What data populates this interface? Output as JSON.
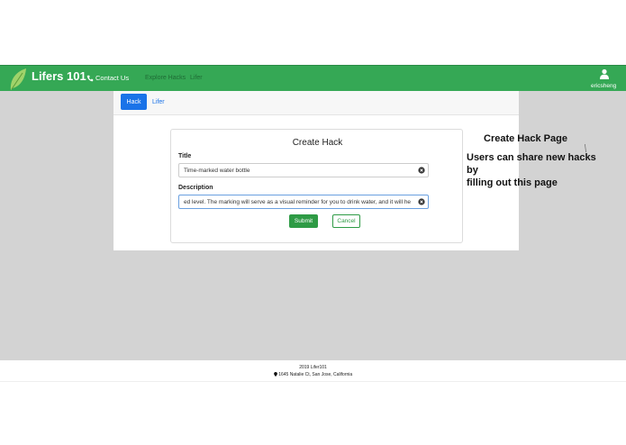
{
  "navbar": {
    "brand": "Lifers 101",
    "contact": "Contact Us",
    "explore": "Explore Hacks",
    "lifer": "Lifer",
    "username": "ericsheng",
    "color": "#35a855"
  },
  "tabs": {
    "hack": "Hack",
    "lifer": "Lifer"
  },
  "form": {
    "heading": "Create Hack",
    "title_label": "Title",
    "title_value": "Time-marked water bottle",
    "description_label": "Description",
    "description_value": "ed level. The marking will serve as a visual reminder for you to drink water, and it will he",
    "submit_label": "Submit",
    "cancel_label": "Cancel"
  },
  "annotation": {
    "title": "Create Hack Page",
    "line1": "Users can share new hacks",
    "line2": "by",
    "line3": "filling out this page"
  },
  "footer": {
    "year": "2019 Lifer101",
    "address": "1645 Natalie Ct, San Jose, California"
  },
  "icons": {
    "logo": "leaf-icon",
    "contact": "phone-icon",
    "user": "user-icon",
    "clear": "clear-x-icon",
    "location": "map-pin-icon"
  },
  "colors": {
    "primary_green": "#35a855",
    "button_green": "#2e9b45",
    "primary_blue": "#1a73e8",
    "background_grey": "#d3d3d3"
  }
}
